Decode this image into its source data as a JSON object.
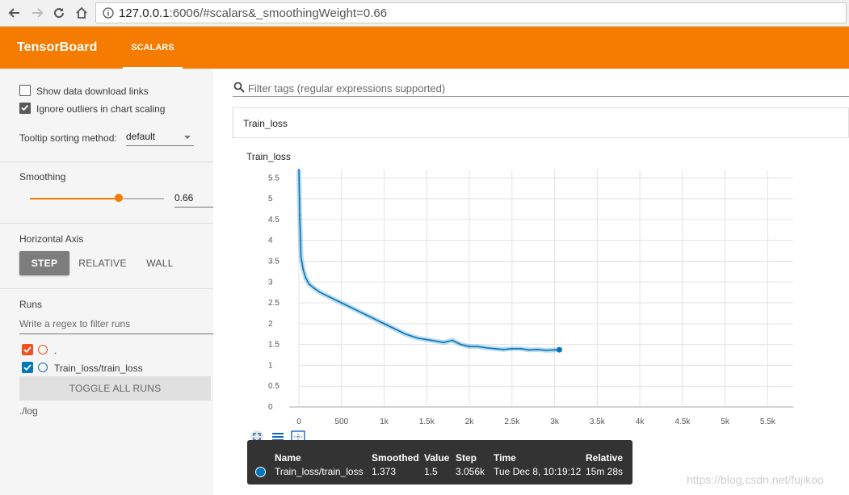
{
  "browser": {
    "url_host": "127.0.0.1",
    "url_rest": ":6006/#scalars&_smoothingWeight=0.66"
  },
  "header": {
    "title": "TensorBoard",
    "tab": "SCALARS",
    "color": "#f57c00"
  },
  "sidebar": {
    "show_download_links": "Show data download links",
    "ignore_outliers": "Ignore outliers in chart scaling",
    "tooltip_sorting_label": "Tooltip sorting method:",
    "tooltip_sorting_value": "default",
    "smoothing_label": "Smoothing",
    "smoothing_value": "0.66",
    "smoothing_fraction": 0.66,
    "horizontal_axis_label": "Horizontal Axis",
    "axis_options": [
      "STEP",
      "RELATIVE",
      "WALL"
    ],
    "axis_selected": "STEP",
    "runs_label": "Runs",
    "run_filter_placeholder": "Write a regex to filter runs",
    "runs": [
      {
        "label": ".",
        "color": "#f4511e",
        "checked": true
      },
      {
        "label": "Train_loss/train_loss",
        "color": "#0077bb",
        "checked": true
      }
    ],
    "toggle_all": "TOGGLE ALL RUNS",
    "logdir": "./log"
  },
  "main": {
    "filter_placeholder": "Filter tags (regular expressions supported)",
    "card_title": "Train_loss",
    "chart_title": "Train_loss"
  },
  "chart_data": {
    "type": "line",
    "title": "Train_loss",
    "xlabel": "",
    "ylabel": "",
    "xlim": [
      0,
      5800
    ],
    "ylim": [
      0,
      5.7
    ],
    "x_ticks": [
      0,
      500,
      1000,
      1500,
      2000,
      2500,
      3000,
      3500,
      4000,
      4500,
      5000,
      5500
    ],
    "x_tick_labels": [
      "0",
      "500",
      "1k",
      "1.5k",
      "2k",
      "2.5k",
      "3k",
      "3.5k",
      "4k",
      "4.5k",
      "5k",
      "5.5k"
    ],
    "y_ticks": [
      0,
      0.5,
      1,
      1.5,
      2,
      2.5,
      3,
      3.5,
      4,
      4.5,
      5,
      5.5
    ],
    "y_tick_labels": [
      "0",
      "0.5",
      "1",
      "1.5",
      "2",
      "2.5",
      "3",
      "3.5",
      "4",
      "4.5",
      "5",
      "5.5"
    ],
    "grid": true,
    "series": [
      {
        "name": "Train_loss/train_loss",
        "color": "#0077bb",
        "x": [
          0,
          10,
          25,
          50,
          80,
          120,
          180,
          250,
          350,
          450,
          550,
          650,
          800,
          950,
          1100,
          1250,
          1400,
          1550,
          1700,
          1800,
          1900,
          2000,
          2100,
          2200,
          2300,
          2400,
          2500,
          2600,
          2700,
          2800,
          2900,
          3000,
          3056
        ],
        "y": [
          5.7,
          4.6,
          3.6,
          3.3,
          3.1,
          2.95,
          2.85,
          2.75,
          2.65,
          2.55,
          2.45,
          2.35,
          2.2,
          2.05,
          1.9,
          1.75,
          1.65,
          1.6,
          1.55,
          1.6,
          1.5,
          1.45,
          1.45,
          1.42,
          1.4,
          1.38,
          1.4,
          1.4,
          1.37,
          1.38,
          1.36,
          1.37,
          1.373
        ]
      }
    ]
  },
  "toolbar": [
    "expand-icon",
    "list-icon",
    "fit-domain-icon"
  ],
  "tooltip": {
    "headers": [
      "Name",
      "Smoothed",
      "Value",
      "Step",
      "Time",
      "Relative"
    ],
    "row": [
      "Train_loss/train_loss",
      "1.373",
      "1.5",
      "3.056k",
      "Tue Dec 8, 10:19:12",
      "15m 28s"
    ]
  },
  "watermark": "https://blog.csdn.net/fujikoo"
}
